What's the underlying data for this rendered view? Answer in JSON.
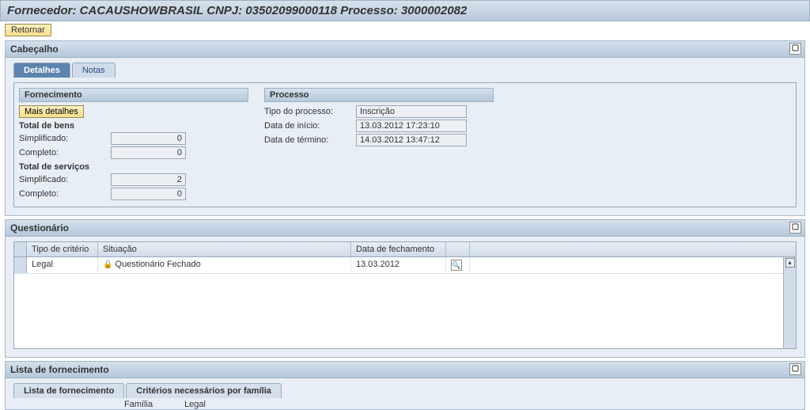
{
  "header": {
    "title": "Fornecedor: CACAUSHOWBRASIL CNPJ: 03502099000118 Processo: 3000002082"
  },
  "toolbar": {
    "return_label": "Retornar"
  },
  "cabecalho": {
    "title": "Cabeçalho",
    "tabs": {
      "detalhes": "Detalhes",
      "notas": "Notas"
    },
    "fornecimento": {
      "title": "Fornecimento",
      "mais_detalhes": "Mais detalhes",
      "total_bens": "Total de bens",
      "simplificado_label": "Simplificado:",
      "completo_label": "Completo:",
      "total_servicos": "Total de serviços",
      "bens_simpl": "0",
      "bens_compl": "0",
      "serv_simpl": "2",
      "serv_compl": "0"
    },
    "processo": {
      "title": "Processo",
      "tipo_label": "Tipo do processo:",
      "tipo_valor": "Inscrição",
      "inicio_label": "Data de início:",
      "inicio_valor": "13.03.2012 17:23:10",
      "termino_label": "Data de término:",
      "termino_valor": "14.03.2012 13:47:12"
    }
  },
  "questionario": {
    "title": "Questionário",
    "cols": {
      "tipo": "Tipo de critério",
      "situacao": "Situação",
      "data": "Data de fechamento"
    },
    "row": {
      "tipo": "Legal",
      "situacao": "Questionário Fechado",
      "data": "13.03.2012"
    }
  },
  "lista": {
    "title": "Lista de fornecimento",
    "tab1": "Lista de fornecimento",
    "tab2": "Critérios necessários por família",
    "sub_familia": "Família",
    "sub_legal": "Legal"
  }
}
